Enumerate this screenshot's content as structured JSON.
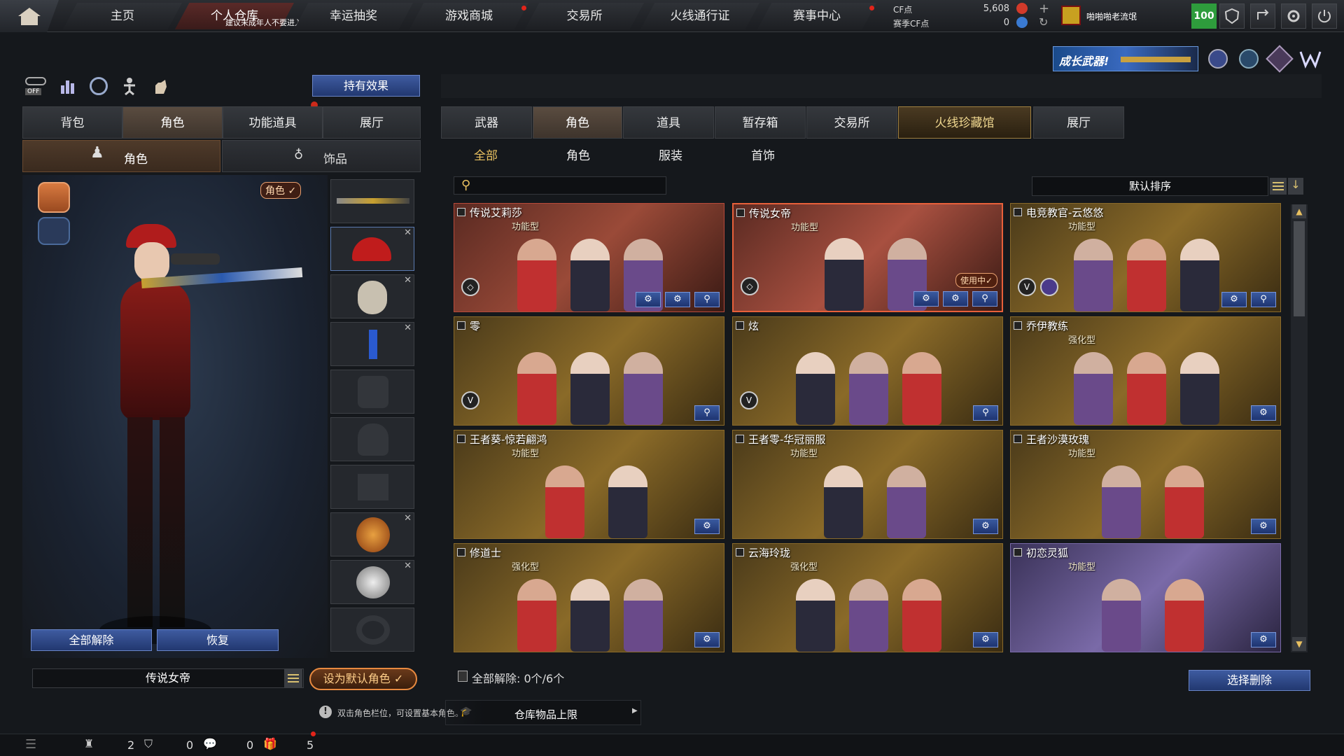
{
  "topnav": {
    "tabs": [
      {
        "label": "主页"
      },
      {
        "label": "个人仓库"
      },
      {
        "label": "幸运抽奖"
      },
      {
        "label": "游戏商城"
      },
      {
        "label": "交易所"
      },
      {
        "label": "火线通行证"
      },
      {
        "label": "赛事中心"
      }
    ],
    "warehouse_tip": "建议未成年人不要进入",
    "cf_label": "CF点",
    "cf_value": "5,608",
    "season_cf_label": "赛季CF点",
    "season_cf_value": "0",
    "username": "啪啪啪老流氓",
    "level": "100"
  },
  "promo": {
    "banner": "成长武器!"
  },
  "left": {
    "effect_button": "持有效果",
    "off_label": "OFF",
    "tabs": [
      {
        "label": "背包"
      },
      {
        "label": "角色"
      },
      {
        "label": "功能道具"
      },
      {
        "label": "展厅"
      }
    ],
    "subtabs": [
      {
        "label": "角色"
      },
      {
        "label": "饰品"
      }
    ],
    "role_tag": "角色 ✓",
    "unequip_all": "全部解除",
    "restore": "恢复",
    "current_role": "传说女帝",
    "set_default": "设为默认角色 ✓"
  },
  "right": {
    "tabs": [
      {
        "label": "武器"
      },
      {
        "label": "角色"
      },
      {
        "label": "道具"
      },
      {
        "label": "暂存箱"
      },
      {
        "label": "交易所"
      },
      {
        "label": "火线珍藏馆"
      },
      {
        "label": "展厅"
      }
    ],
    "subtabs": [
      {
        "label": "全部"
      },
      {
        "label": "角色"
      },
      {
        "label": "服装"
      },
      {
        "label": "首饰"
      }
    ],
    "search_placeholder": "",
    "sort_label": "默认排序",
    "footer_text": "全部解除:  0个/6个",
    "select_delete": "选择删除"
  },
  "cards": [
    {
      "name": "传说艾莉莎",
      "type": "功能型",
      "style": "red"
    },
    {
      "name": "传说女帝",
      "type": "功能型",
      "style": "redsel",
      "status": "使用中✓"
    },
    {
      "name": "电竞教官-云悠悠",
      "type": "功能型",
      "style": "gold"
    },
    {
      "name": "零",
      "type": "",
      "style": "gold"
    },
    {
      "name": "炫",
      "type": "",
      "style": "gold"
    },
    {
      "name": "乔伊教练",
      "type": "强化型",
      "style": "gold"
    },
    {
      "name": "王者葵-惊若翩鸿",
      "type": "功能型",
      "style": "gold"
    },
    {
      "name": "王者零-华冠丽服",
      "type": "功能型",
      "style": "gold"
    },
    {
      "name": "王者沙漠玫瑰",
      "type": "功能型",
      "style": "gold"
    },
    {
      "name": "修道士",
      "type": "强化型",
      "style": "gold"
    },
    {
      "name": "云海玲珑",
      "type": "强化型",
      "style": "gold"
    },
    {
      "name": "初恋灵狐",
      "type": "功能型",
      "style": "purple"
    }
  ],
  "bottom": {
    "hint": "双击角色栏位，可设置基本角色。",
    "capacity": "仓库物品上限",
    "counts": [
      "2",
      "0",
      "0",
      "5"
    ]
  },
  "colors": {
    "accent_red": "#e2241a",
    "button_blue": "#2d4a8e",
    "gold": "#8a6a28"
  }
}
